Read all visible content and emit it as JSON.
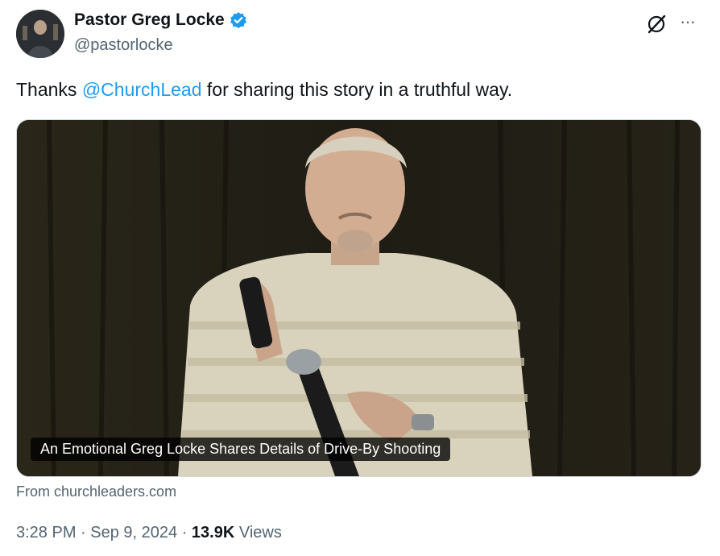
{
  "tweet": {
    "author": {
      "display_name": "Pastor Greg Locke",
      "handle": "@pastorlocke",
      "verified_icon": "verified-badge-icon",
      "avatar_icon": "avatar"
    },
    "text_before": "Thanks ",
    "mention": "@ChurchLead",
    "text_after": " for sharing this story in a truthful way.",
    "card": {
      "caption": "An Emotional Greg Locke Shares Details of Drive-By Shooting",
      "source": "From churchleaders.com"
    },
    "meta": {
      "time": "3:28 PM",
      "separator1": " · ",
      "date": "Sep 9, 2024",
      "separator2": " · ",
      "views_count": "13.9K",
      "views_label": " Views"
    }
  },
  "header_icons": {
    "grok": "grok-icon",
    "more": "···"
  },
  "colors": {
    "accent": "#1d9bf0",
    "text": "#0f1419",
    "secondary": "#536471"
  }
}
